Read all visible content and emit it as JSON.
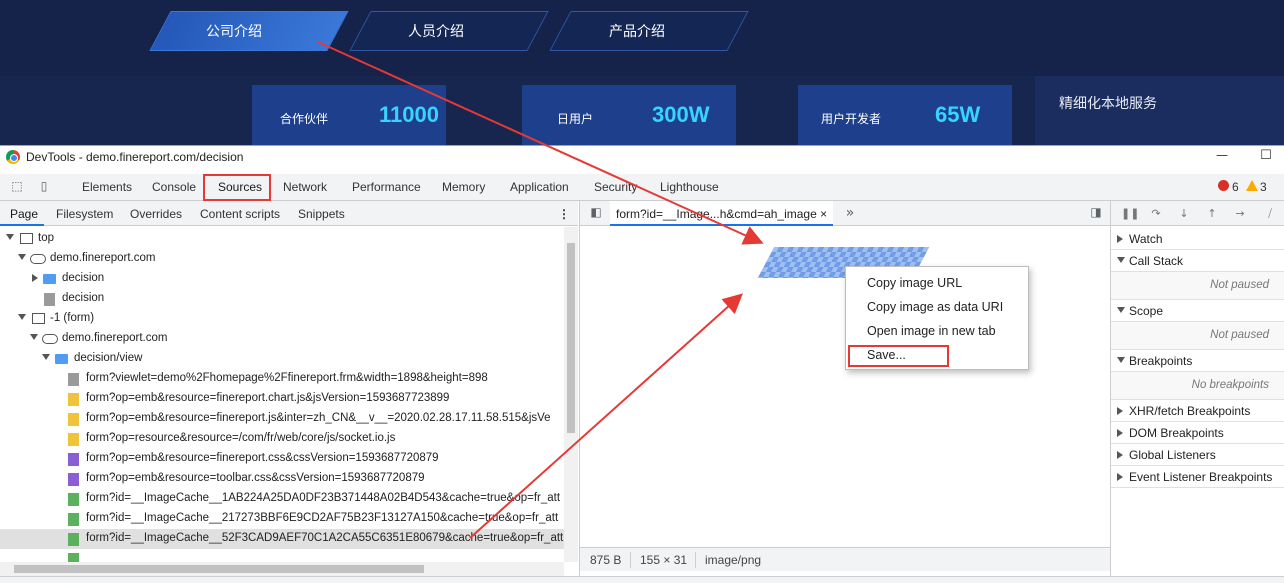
{
  "site": {
    "nav": [
      "公司介绍",
      "人员介绍",
      "产品介绍"
    ],
    "stats": [
      {
        "label": "合作伙伴",
        "value": "11000"
      },
      {
        "label": "日用户",
        "value": "300W"
      },
      {
        "label": "用户开发者",
        "value": "65W"
      }
    ],
    "service": "精细化本地服务"
  },
  "devtools": {
    "window_title": "DevTools - demo.finereport.com/decision",
    "window_buttons": {
      "minimize": "—",
      "maximize": "☐"
    },
    "main_tabs": [
      "Elements",
      "Console",
      "Sources",
      "Network",
      "Performance",
      "Memory",
      "Application",
      "Security",
      "Lighthouse"
    ],
    "selected_main_tab": "Sources",
    "errors": "6",
    "warnings": "3",
    "sub_tabs": [
      "Page",
      "Filesystem",
      "Overrides",
      "Content scripts",
      "Snippets"
    ],
    "tree": [
      "top",
      "demo.finereport.com",
      "decision",
      "decision",
      "-1 (form)",
      "demo.finereport.com",
      "decision/view",
      "form?viewlet=demo%2Fhomepage%2Ffinereport.frm&width=1898&height=898",
      "form?op=emb&resource=finereport.chart.js&jsVersion=1593687723899",
      "form?op=emb&resource=finereport.js&inter=zh_CN&__v__=2020.02.28.17.11.58.515&jsVe",
      "form?op=resource&resource=/com/fr/web/core/js/socket.io.js",
      "form?op=emb&resource=finereport.css&cssVersion=1593687720879",
      "form?op=emb&resource=toolbar.css&cssVersion=1593687720879",
      "form?id=__ImageCache__1AB224A25DA0DF23B371448A02B4D543&cache=true&op=fr_att",
      "form?id=__ImageCache__217273BBF6E9CD2AF75B23F13127A150&cache=true&op=fr_att",
      "form?id=__ImageCache__52F3CAD9AEF70C1A2CA55C6351E80679&cache=true&op=fr_att"
    ],
    "editor_tab": "form?id=__Image...h&cmd=ah_image",
    "more_tabs": "»",
    "close_glyph": "×",
    "status": {
      "size": "875 B",
      "dims": "155 × 31",
      "mime": "image/png"
    },
    "context_menu": [
      "Copy image URL",
      "Copy image as data URI",
      "Open image in new tab",
      "Save..."
    ],
    "sidebar": {
      "watch": "Watch",
      "call_stack": "Call Stack",
      "call_stack_body": "Not paused",
      "scope": "Scope",
      "scope_body": "Not paused",
      "breakpoints": "Breakpoints",
      "breakpoints_body": "No breakpoints",
      "xhr": "XHR/fetch Breakpoints",
      "dom": "DOM Breakpoints",
      "global": "Global Listeners",
      "event": "Event Listener Breakpoints"
    }
  },
  "colors": {
    "site_bg": "#16264f",
    "stat_number": "#39d3ff",
    "highlight": "#e53935",
    "selection_blue": "#1a73e8"
  }
}
